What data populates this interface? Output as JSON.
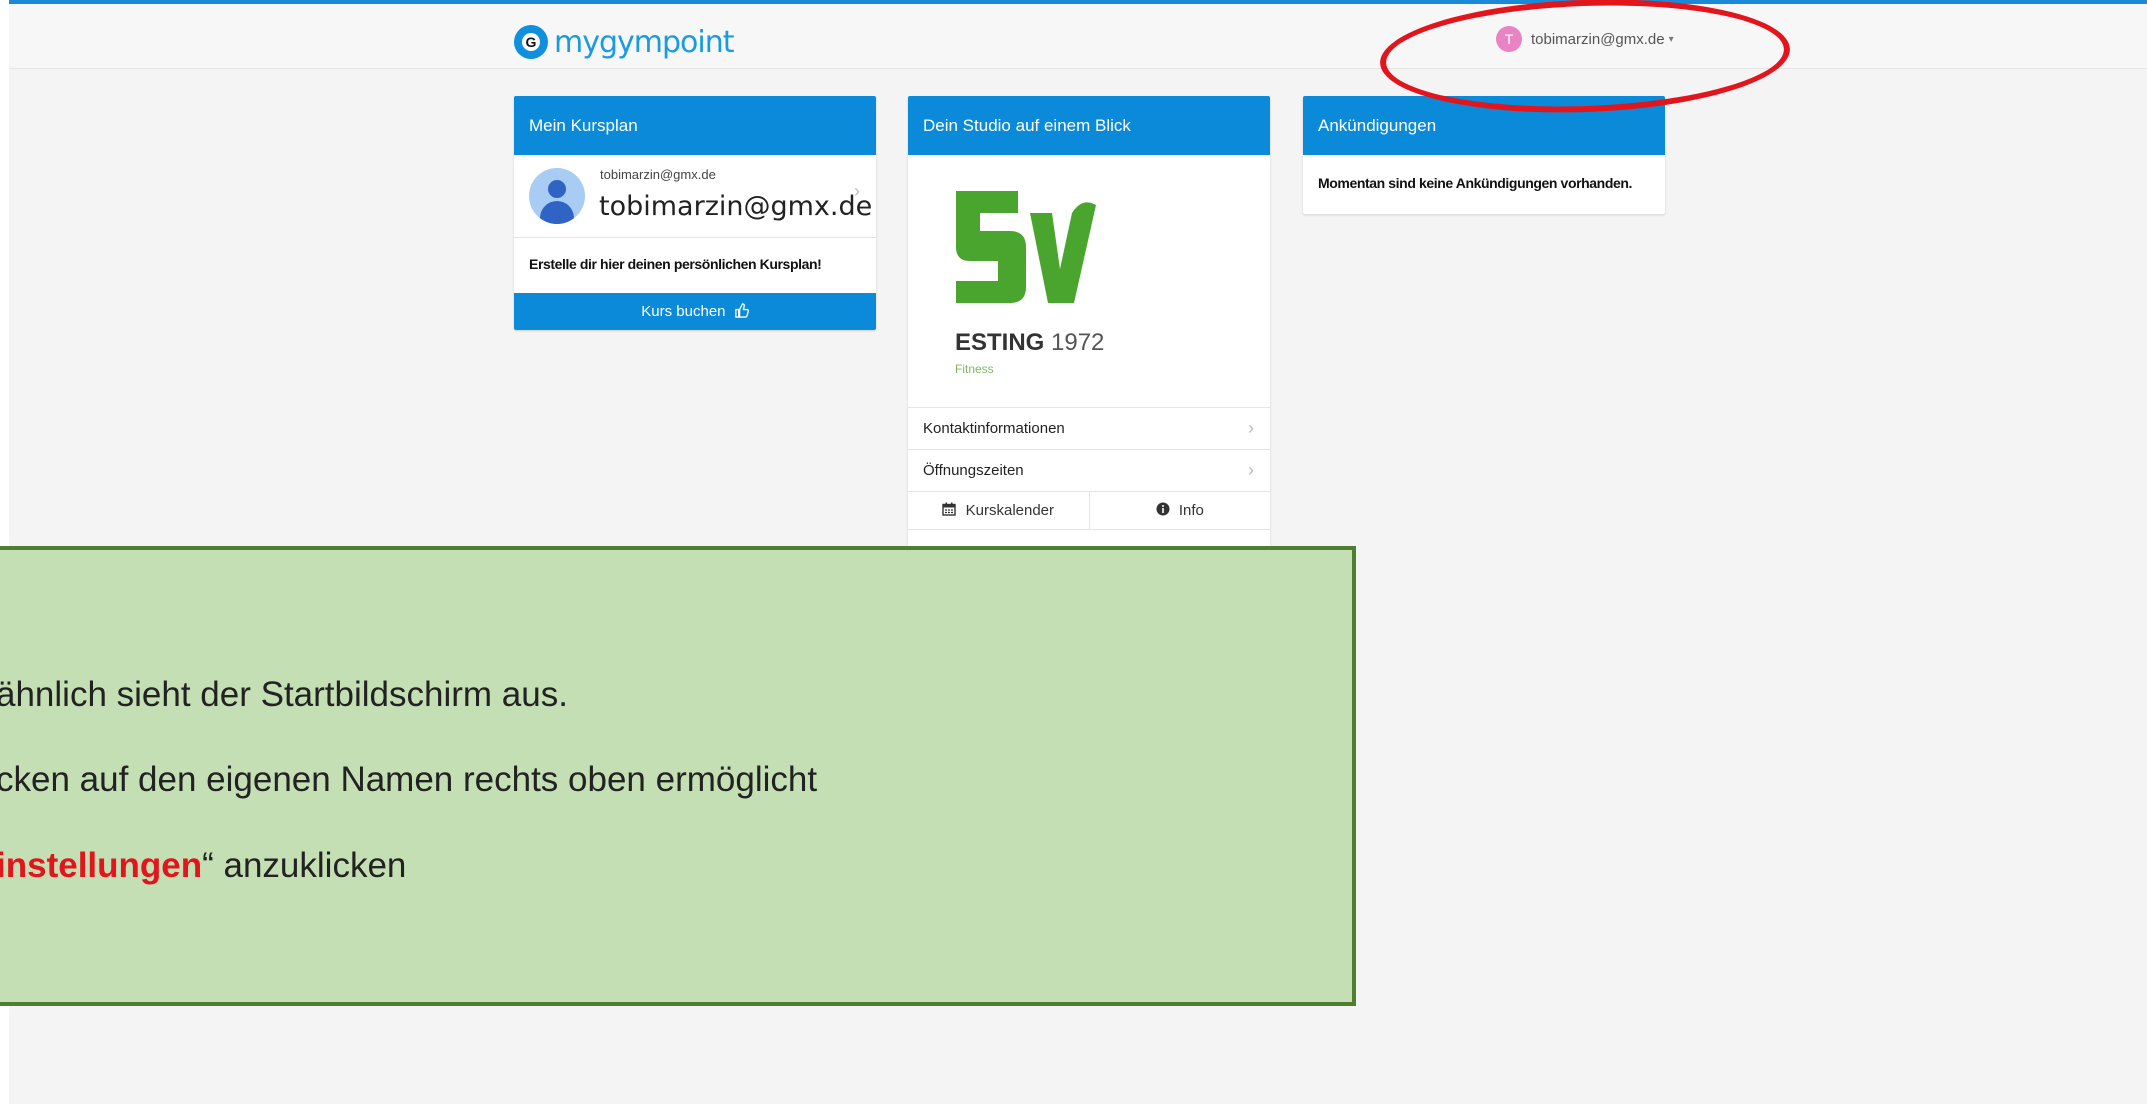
{
  "header": {
    "logo_text": "mygympoint",
    "logo_letter": "G",
    "user_initial": "T",
    "user_email": "tobimarzin@gmx.de",
    "caret": "▾"
  },
  "kursplan": {
    "title": "Mein Kursplan",
    "email_small": "tobimarzin@gmx.de",
    "email_big": "tobimarzin@gmx.de",
    "hint": "Erstelle dir hier deinen persönlichen Kursplan!",
    "button_label": "Kurs buchen",
    "button_icon": "thumbs-up-icon"
  },
  "studio": {
    "title": "Dein Studio auf einem Blick",
    "logo_name": "ESTING",
    "logo_year": "1972",
    "logo_sub": "Fitness",
    "rows": [
      {
        "label": "Kontaktinformationen"
      },
      {
        "label": "Öffnungszeiten"
      }
    ],
    "calendar_label": "Kurskalender",
    "info_label": "Info"
  },
  "announcements": {
    "title": "Ankündigungen",
    "text": "Momentan sind keine Ankündigungen vorhanden."
  },
  "overlay": {
    "line1": "ähnlich sieht der Startbildschirm aus.",
    "line2": "cken auf den eigenen Namen rechts oben ermöglicht",
    "line3_red": "instellungen",
    "line3_rest": "“ anzuklicken"
  },
  "colors": {
    "accent": "#0a8ad8",
    "logo_green": "#4aa52e",
    "overlay_bg": "#c4dfb4",
    "overlay_border": "#4f7d32",
    "highlight_red": "#e2151c"
  }
}
